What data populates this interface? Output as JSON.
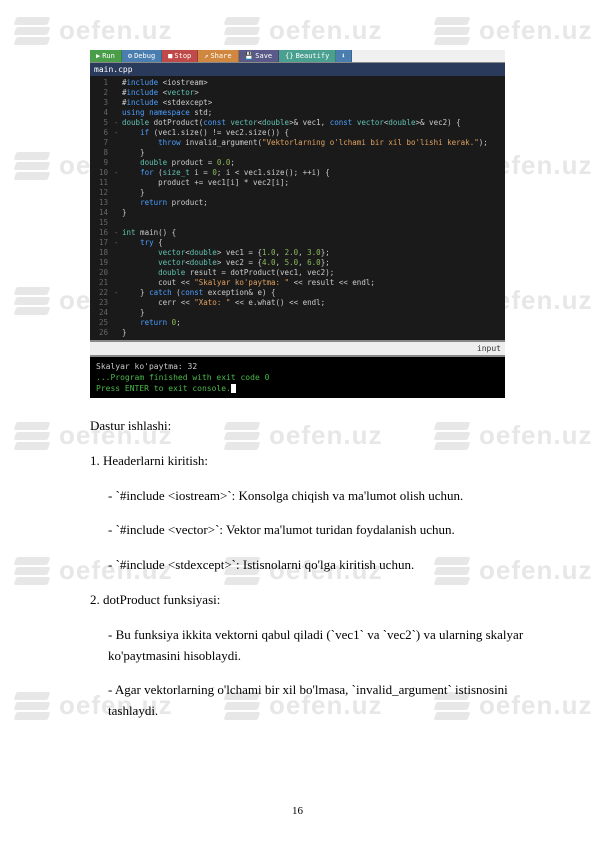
{
  "watermark_text": "oefen.uz",
  "ide": {
    "toolbar": {
      "run": "Run",
      "debug": "Debug",
      "stop": "Stop",
      "share": "Share",
      "save": "Save",
      "beautify": "Beautify",
      "download": ""
    },
    "tab": "main.cpp",
    "input_label": "input",
    "code": [
      {
        "n": "1",
        "f": "",
        "txt": "#include <iostream>",
        "cls": "kw2"
      },
      {
        "n": "2",
        "f": "",
        "txt": "#include <vector>",
        "cls": "kw2"
      },
      {
        "n": "3",
        "f": "",
        "txt": "#include <stdexcept>",
        "cls": "kw2"
      },
      {
        "n": "4",
        "f": "",
        "txt": "using namespace std;",
        "cls": "kw"
      },
      {
        "n": "5",
        "f": "-",
        "txt": "double dotProduct(const vector<double>& vec1, const vector<double>& vec2) {",
        "cls": ""
      },
      {
        "n": "6",
        "f": "-",
        "txt": "    if (vec1.size() != vec2.size()) {",
        "cls": ""
      },
      {
        "n": "7",
        "f": "",
        "txt": "        throw invalid_argument(\"Vektorlarning o'lchami bir xil bo'lishi kerak.\");",
        "cls": ""
      },
      {
        "n": "8",
        "f": "",
        "txt": "    }",
        "cls": ""
      },
      {
        "n": "9",
        "f": "",
        "txt": "    double product = 0.0;",
        "cls": ""
      },
      {
        "n": "10",
        "f": "-",
        "txt": "    for (size_t i = 0; i < vec1.size(); ++i) {",
        "cls": ""
      },
      {
        "n": "11",
        "f": "",
        "txt": "        product += vec1[i] * vec2[i];",
        "cls": ""
      },
      {
        "n": "12",
        "f": "",
        "txt": "    }",
        "cls": ""
      },
      {
        "n": "13",
        "f": "",
        "txt": "    return product;",
        "cls": ""
      },
      {
        "n": "14",
        "f": "",
        "txt": "}",
        "cls": ""
      },
      {
        "n": "15",
        "f": "",
        "txt": "",
        "cls": ""
      },
      {
        "n": "16",
        "f": "-",
        "txt": "int main() {",
        "cls": ""
      },
      {
        "n": "17",
        "f": "-",
        "txt": "    try {",
        "cls": ""
      },
      {
        "n": "18",
        "f": "",
        "txt": "        vector<double> vec1 = {1.0, 2.0, 3.0};",
        "cls": ""
      },
      {
        "n": "19",
        "f": "",
        "txt": "        vector<double> vec2 = {4.0, 5.0, 6.0};",
        "cls": ""
      },
      {
        "n": "20",
        "f": "",
        "txt": "        double result = dotProduct(vec1, vec2);",
        "cls": ""
      },
      {
        "n": "21",
        "f": "",
        "txt": "        cout << \"Skalyar ko'paytma: \" << result << endl;",
        "cls": ""
      },
      {
        "n": "22",
        "f": "-",
        "txt": "    } catch (const exception& e) {",
        "cls": ""
      },
      {
        "n": "23",
        "f": "",
        "txt": "        cerr << \"Xato: \" << e.what() << endl;",
        "cls": ""
      },
      {
        "n": "24",
        "f": "",
        "txt": "    }",
        "cls": ""
      },
      {
        "n": "25",
        "f": "",
        "txt": "    return 0;",
        "cls": ""
      },
      {
        "n": "26",
        "f": "",
        "txt": "}",
        "cls": ""
      }
    ],
    "output": {
      "line1": "Skalyar ko'paytma: 32",
      "line2": "",
      "line3": "...Program finished with exit code 0",
      "line4": "Press ENTER to exit console."
    }
  },
  "body": {
    "p1": "Dastur ishlashi:",
    "p2": "1. Headerlarni kiritish:",
    "p3": "   - `#include <iostream>`: Konsolga chiqish va ma'lumot olish uchun.",
    "p4": "   - `#include <vector>`: Vektor ma'lumot turidan foydalanish uchun.",
    "p5": "   - `#include <stdexcept>`: Istisnolarni qo'lga kiritish uchun.",
    "p6": "2. dotProduct funksiyasi:",
    "p7": "   - Bu funksiya ikkita vektorni qabul qiladi (`vec1` va `vec2`) va ularning skalyar ko'paytmasini hisoblaydi.",
    "p8": "   - Agar vektorlarning o'lchami bir xil bo'lmasa, `invalid_argument` istisnosini tashlaydi."
  },
  "page_number": "16"
}
